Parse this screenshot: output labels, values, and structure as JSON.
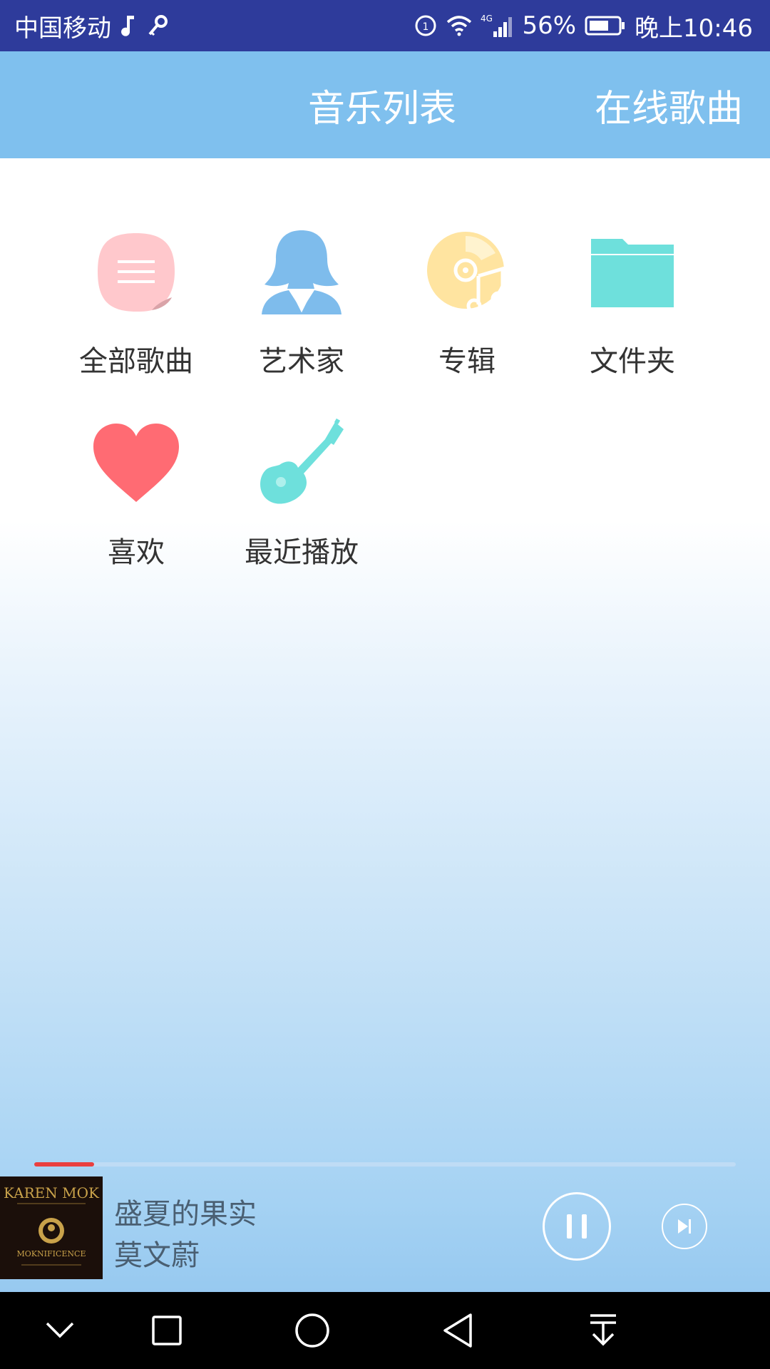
{
  "status_bar": {
    "carrier": "中国移动",
    "network": "4G",
    "battery": "56%",
    "time": "晚上10:46",
    "icons": [
      "music-note-icon",
      "key-icon",
      "data-saver-icon",
      "wifi-icon",
      "signal-icon",
      "battery-icon"
    ]
  },
  "header": {
    "tabs": [
      {
        "label": "音乐列表"
      },
      {
        "label": "在线歌曲"
      }
    ]
  },
  "categories": [
    {
      "label": "全部歌曲",
      "icon": "all-songs-icon",
      "color": "#ffc8cc"
    },
    {
      "label": "艺术家",
      "icon": "artist-icon",
      "color": "#7ebcec"
    },
    {
      "label": "专辑",
      "icon": "album-icon",
      "color": "#ffe4a0"
    },
    {
      "label": "文件夹",
      "icon": "folder-icon",
      "color": "#6ee0dc"
    },
    {
      "label": "喜欢",
      "icon": "heart-icon",
      "color": "#ff6b73"
    },
    {
      "label": "最近播放",
      "icon": "guitar-icon",
      "color": "#6ee0dc"
    }
  ],
  "player": {
    "title": "盛夏的果实",
    "artist": "莫文蔚",
    "album_art": {
      "name": "KAREN MOK",
      "subtitle": "MOKNIFICENCE"
    },
    "progress_fraction": 0.085,
    "progress_color": "#ea3f3f",
    "state": "playing"
  },
  "nav_bar": {
    "buttons": [
      "chevron-down-icon",
      "square-icon",
      "circle-home-icon",
      "back-triangle-icon",
      "download-arrow-icon"
    ]
  }
}
